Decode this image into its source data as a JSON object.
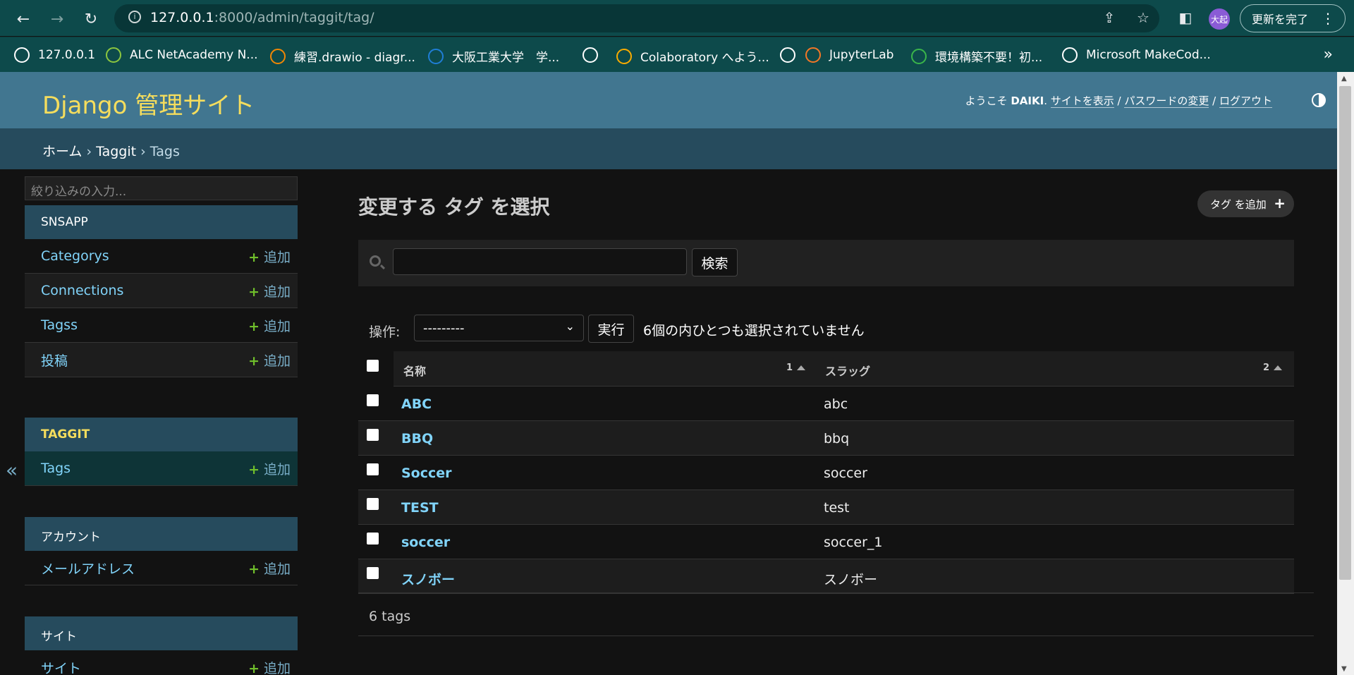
{
  "browser": {
    "url_host": "127.0.0.1",
    "url_rest": ":8000/admin/taggit/tag/",
    "avatar_text": "大起",
    "update_label": "更新を完了",
    "bookmarks": [
      {
        "label": "127.0.0.1",
        "icon": "globe-icon",
        "color": "#ffffff"
      },
      {
        "label": "ALC NetAcademy N...",
        "icon": "alc-icon",
        "color": "#8cc63f"
      },
      {
        "label": "練習.drawio - diagr...",
        "icon": "drawio-icon",
        "color": "#f08705"
      },
      {
        "label": "大阪工業大学　学...",
        "icon": "oit-icon",
        "color": "#1f7ed6"
      },
      {
        "label": "",
        "icon": "globe-icon",
        "color": "#ffffff"
      },
      {
        "label": "Colaboratory へよう...",
        "icon": "colab-icon",
        "color": "#f9ab00"
      },
      {
        "label": "",
        "icon": "globe-icon",
        "color": "#ffffff"
      },
      {
        "label": "JupyterLab",
        "icon": "jupyter-icon",
        "color": "#f37726"
      },
      {
        "label": "環境構築不要！初...",
        "icon": "paiza-icon",
        "color": "#3ab54a"
      },
      {
        "label": "Microsoft MakeCod...",
        "icon": "makecode-icon",
        "color": "#ffffff"
      }
    ]
  },
  "header": {
    "branding": "Django 管理サイト",
    "welcome": "ようこそ ",
    "username": "DAIKI",
    "sep0": ". ",
    "view_site": "サイトを表示",
    "sep1": " / ",
    "password_change": "パスワードの変更",
    "sep2": " / ",
    "logout": "ログアウト"
  },
  "breadcrumbs": {
    "home": "ホーム",
    "sep": " › ",
    "app": "Taggit",
    "current": "Tags"
  },
  "sidebar": {
    "filter_placeholder": "絞り込みの入力...",
    "toggle": "«",
    "add_label": "追加",
    "modules": [
      {
        "caption": "SNSAPP",
        "models": [
          "Categorys",
          "Connections",
          "Tagss",
          "投稿"
        ]
      },
      {
        "caption": "TAGGIT",
        "models": [
          "Tags"
        ]
      },
      {
        "caption": "アカウント",
        "models": [
          "メールアドレス"
        ]
      },
      {
        "caption": "サイト",
        "models": [
          "サイト"
        ]
      }
    ]
  },
  "content": {
    "title": "変更する タグ を選択",
    "add_button": "タグ を追加",
    "search_button": "検索",
    "action_label": "操作:",
    "action_selected": "---------",
    "go_button": "実行",
    "action_counter": "6個の内ひとつも選択されていません",
    "columns": [
      {
        "label": "名称",
        "sort_priority": "1"
      },
      {
        "label": "スラッグ",
        "sort_priority": "2"
      }
    ],
    "rows": [
      {
        "name": "ABC",
        "slug": "abc"
      },
      {
        "name": "BBQ",
        "slug": "bbq"
      },
      {
        "name": "Soccer",
        "slug": "soccer"
      },
      {
        "name": "TEST",
        "slug": "test"
      },
      {
        "name": "soccer",
        "slug": "soccer_1"
      },
      {
        "name": "スノボー",
        "slug": "スノボー"
      }
    ],
    "paginator": "6 tags"
  },
  "colors": {
    "header_bg": "#417690",
    "branding": "#f5dd5d",
    "link": "#81d4fa",
    "add_plus": "#70bf2b"
  }
}
